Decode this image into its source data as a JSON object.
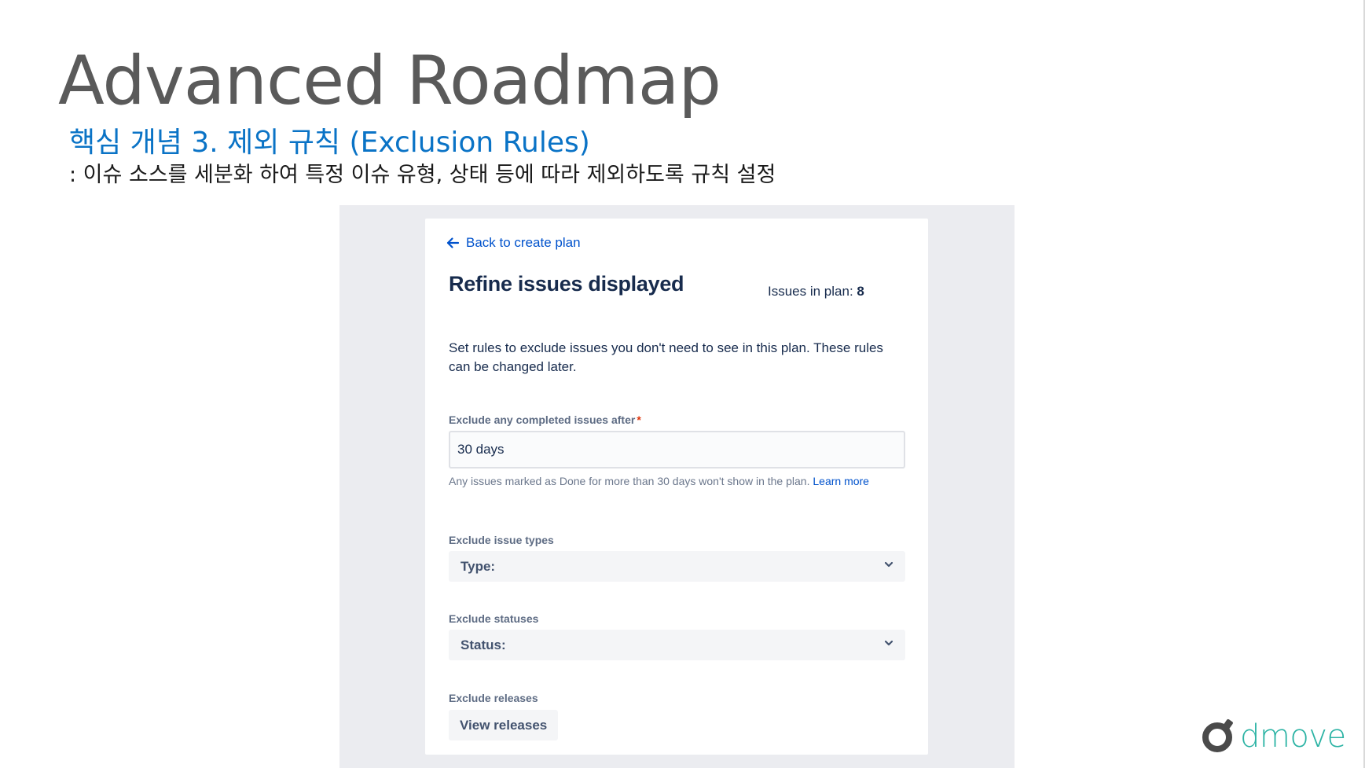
{
  "slide": {
    "title": "Advanced Roadmap",
    "subtitle": "핵심 개념 3. 제외 규칙 (Exclusion Rules)",
    "description": ": 이슈 소스를 세분화 하여 특정 이슈 유형, 상태 등에 따라 제외하도록 규칙 설정"
  },
  "panel": {
    "back_link": "Back to create plan",
    "title": "Refine issues displayed",
    "issues_in_plan_label": "Issues in plan: ",
    "issues_in_plan_count": "8",
    "intro": "Set rules to exclude issues you don't need to see in this plan. These rules can be changed later.",
    "completed": {
      "label": "Exclude any completed issues after",
      "required_mark": "*",
      "value": "30 days",
      "helper": "Any issues marked as Done for more than 30 days won't show in the plan.",
      "learn_more": "Learn more"
    },
    "issue_types": {
      "label": "Exclude issue types",
      "select_label": "Type:"
    },
    "statuses": {
      "label": "Exclude statuses",
      "select_label": "Status:"
    },
    "releases": {
      "label": "Exclude releases",
      "button": "View releases"
    }
  },
  "logo": {
    "text": "dmove"
  },
  "icons": {
    "back": "arrow-left-icon",
    "dropdown": "chevron-down-icon",
    "logo_mark": "dmove-logo-mark"
  },
  "colors": {
    "title_gray": "#5a5a5a",
    "subtitle_blue": "#0a73c6",
    "link_blue": "#0052cc",
    "heading_navy": "#172b4d",
    "label_gray": "#5e6c84",
    "required_red": "#de350b",
    "screenshot_bg": "#ebecf0",
    "field_bg": "#f4f5f7",
    "logo_teal": "#2bb3a4",
    "logo_dark": "#4a4a4a"
  }
}
